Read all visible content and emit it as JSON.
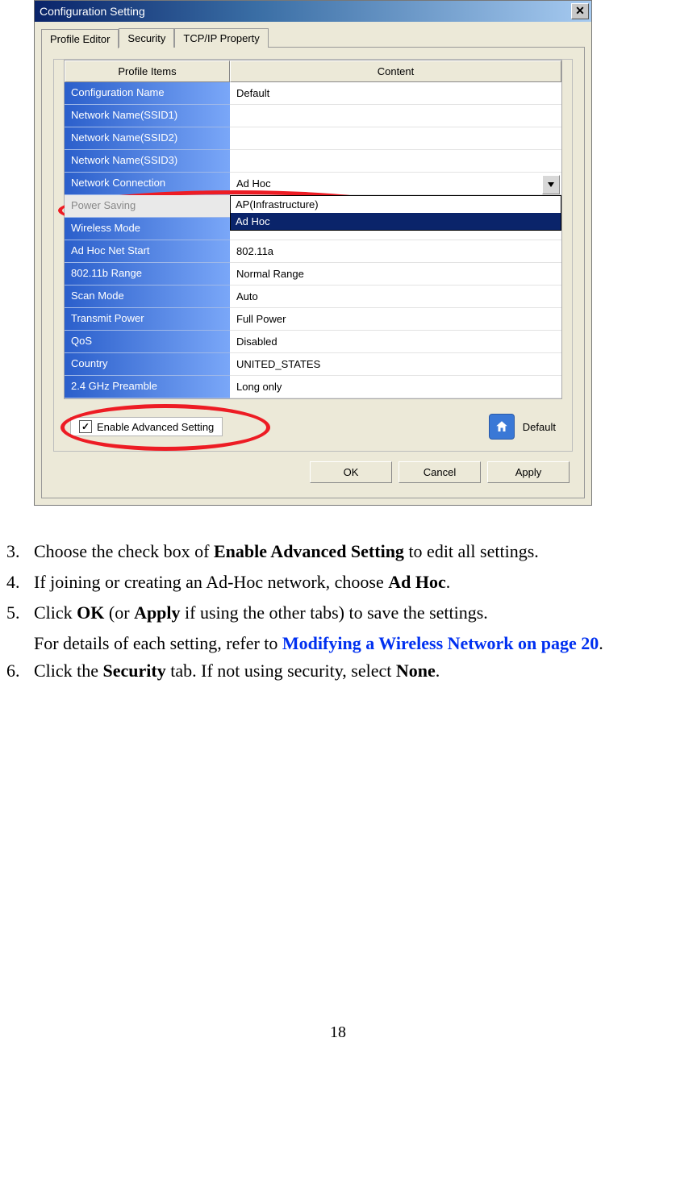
{
  "dialog": {
    "title": "Configuration Setting",
    "close_label": "✕",
    "tabs": [
      "Profile Editor",
      "Security",
      "TCP/IP Property"
    ],
    "headers": {
      "left": "Profile Items",
      "right": "Content"
    },
    "rows": [
      {
        "label": "Configuration Name",
        "value": "Default",
        "disabled": false
      },
      {
        "label": "Network Name(SSID1)",
        "value": "",
        "disabled": false
      },
      {
        "label": "Network Name(SSID2)",
        "value": "",
        "disabled": false
      },
      {
        "label": "Network Name(SSID3)",
        "value": "",
        "disabled": false
      },
      {
        "label": "Network Connection",
        "value": "Ad Hoc",
        "disabled": false,
        "dropdown": true
      },
      {
        "label": "Power Saving",
        "value": "",
        "disabled": true
      },
      {
        "label": "Wireless Mode",
        "value": "",
        "disabled": false
      },
      {
        "label": "Ad Hoc Net Start",
        "value": "802.11a",
        "disabled": false
      },
      {
        "label": "802.11b Range",
        "value": "Normal Range",
        "disabled": false
      },
      {
        "label": "Scan Mode",
        "value": "Auto",
        "disabled": false
      },
      {
        "label": "Transmit Power",
        "value": "Full Power",
        "disabled": false
      },
      {
        "label": "QoS",
        "value": "Disabled",
        "disabled": false
      },
      {
        "label": "Country",
        "value": "UNITED_STATES",
        "disabled": false
      },
      {
        "label": "2.4 GHz Preamble",
        "value": "Long only",
        "disabled": false
      }
    ],
    "dropdown_options": [
      "AP(Infrastructure)",
      "Ad Hoc"
    ],
    "checkbox_label": "Enable Advanced Setting",
    "default_label": "Default",
    "buttons": {
      "ok": "OK",
      "cancel": "Cancel",
      "apply": "Apply"
    }
  },
  "instructions": {
    "i3": {
      "num": "3.",
      "pre": "Choose the check box of ",
      "bold": "Enable Advanced Setting",
      "post": " to edit all settings."
    },
    "i4": {
      "num": "4.",
      "pre": "If joining or creating an Ad-Hoc network, choose ",
      "bold": "Ad Hoc",
      "post": "."
    },
    "i5": {
      "num": "5.",
      "pre": "Click ",
      "b1": "OK",
      "mid": " (or ",
      "b2": "Apply",
      "post": " if using the other tabs) to save the settings."
    },
    "i5b": {
      "pre": "For details of each setting, refer to ",
      "link": "Modifying a Wireless Network on page 20",
      "post": "."
    },
    "i6": {
      "num": "6.",
      "pre": "Click the ",
      "b1": "Security",
      "mid": " tab. If not using security, select ",
      "b2": "None",
      "post": "."
    }
  },
  "page_number": "18"
}
